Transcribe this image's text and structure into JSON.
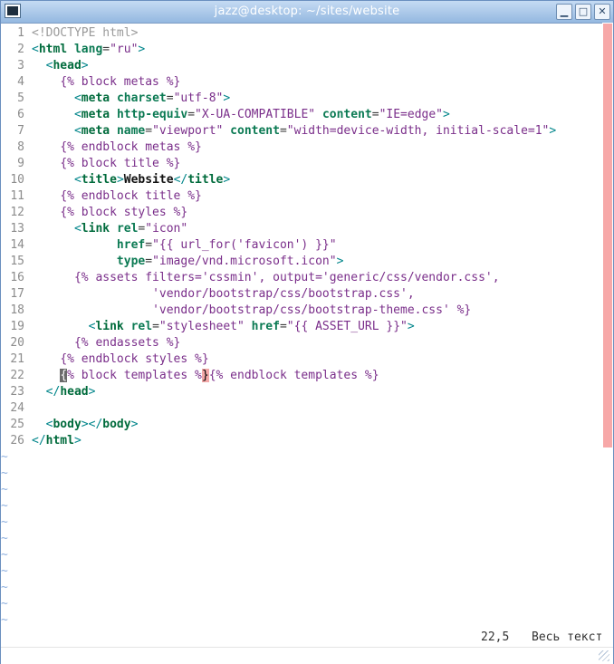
{
  "window": {
    "title": "jazz@desktop: ~/sites/website",
    "controls": {
      "minimize": "▁",
      "maximize": "□",
      "close": "✕"
    }
  },
  "editor": {
    "lines": [
      {
        "n": "1",
        "parts": [
          [
            "doctype",
            "<!DOCTYPE html>"
          ]
        ]
      },
      {
        "n": "2",
        "parts": [
          [
            "tag",
            "<"
          ],
          [
            "tagname",
            "html "
          ],
          [
            "attr",
            "lang"
          ],
          [
            "txt",
            "="
          ],
          [
            "str",
            "\"ru\""
          ],
          [
            "tag",
            ">"
          ]
        ]
      },
      {
        "n": "3",
        "parts": [
          [
            "txt",
            "  "
          ],
          [
            "tag",
            "<"
          ],
          [
            "tagname",
            "head"
          ],
          [
            "tag",
            ">"
          ]
        ]
      },
      {
        "n": "4",
        "parts": [
          [
            "txt",
            "    "
          ],
          [
            "tmpl",
            "{% block metas %}"
          ]
        ]
      },
      {
        "n": "5",
        "parts": [
          [
            "txt",
            "      "
          ],
          [
            "tag",
            "<"
          ],
          [
            "tagname",
            "meta "
          ],
          [
            "attr",
            "charset"
          ],
          [
            "txt",
            "="
          ],
          [
            "str",
            "\"utf-8\""
          ],
          [
            "tag",
            ">"
          ]
        ]
      },
      {
        "n": "6",
        "parts": [
          [
            "txt",
            "      "
          ],
          [
            "tag",
            "<"
          ],
          [
            "tagname",
            "meta "
          ],
          [
            "attr",
            "http-equiv"
          ],
          [
            "txt",
            "="
          ],
          [
            "str",
            "\"X-UA-COMPATIBLE\" "
          ],
          [
            "attr",
            "content"
          ],
          [
            "txt",
            "="
          ],
          [
            "str",
            "\"IE=edge\""
          ],
          [
            "tag",
            ">"
          ]
        ]
      },
      {
        "n": "7",
        "parts": [
          [
            "txt",
            "      "
          ],
          [
            "tag",
            "<"
          ],
          [
            "tagname",
            "meta "
          ],
          [
            "attr",
            "name"
          ],
          [
            "txt",
            "="
          ],
          [
            "str",
            "\"viewport\" "
          ],
          [
            "attr",
            "content"
          ],
          [
            "txt",
            "="
          ],
          [
            "str",
            "\"width=device-width, initial-scale=1\""
          ],
          [
            "tag",
            ">"
          ]
        ]
      },
      {
        "n": "8",
        "parts": [
          [
            "txt",
            "    "
          ],
          [
            "tmpl",
            "{% endblock metas %}"
          ]
        ]
      },
      {
        "n": "9",
        "parts": [
          [
            "txt",
            "    "
          ],
          [
            "tmpl",
            "{% block title %}"
          ]
        ]
      },
      {
        "n": "10",
        "parts": [
          [
            "txt",
            "      "
          ],
          [
            "tag",
            "<"
          ],
          [
            "tagname",
            "title"
          ],
          [
            "tag",
            ">"
          ],
          [
            "bold",
            "Website"
          ],
          [
            "tag",
            "</"
          ],
          [
            "tagname",
            "title"
          ],
          [
            "tag",
            ">"
          ]
        ]
      },
      {
        "n": "11",
        "parts": [
          [
            "txt",
            "    "
          ],
          [
            "tmpl",
            "{% endblock title %}"
          ]
        ]
      },
      {
        "n": "12",
        "parts": [
          [
            "txt",
            "    "
          ],
          [
            "tmpl",
            "{% block styles %}"
          ]
        ]
      },
      {
        "n": "13",
        "parts": [
          [
            "txt",
            "      "
          ],
          [
            "tag",
            "<"
          ],
          [
            "tagname",
            "link "
          ],
          [
            "attr",
            "rel"
          ],
          [
            "txt",
            "="
          ],
          [
            "str",
            "\"icon\""
          ]
        ]
      },
      {
        "n": "14",
        "parts": [
          [
            "txt",
            "            "
          ],
          [
            "attr",
            "href"
          ],
          [
            "txt",
            "="
          ],
          [
            "str",
            "\"{{ url_for('favicon') }}\""
          ]
        ]
      },
      {
        "n": "15",
        "parts": [
          [
            "txt",
            "            "
          ],
          [
            "attr",
            "type"
          ],
          [
            "txt",
            "="
          ],
          [
            "str",
            "\"image/vnd.microsoft.icon\""
          ],
          [
            "tag",
            ">"
          ]
        ]
      },
      {
        "n": "16",
        "parts": [
          [
            "txt",
            "      "
          ],
          [
            "tmpl",
            "{% assets filters='cssmin', output='generic/css/vendor.css',"
          ]
        ]
      },
      {
        "n": "17",
        "parts": [
          [
            "txt",
            "                 "
          ],
          [
            "tmpl",
            "'vendor/bootstrap/css/bootstrap.css',"
          ]
        ]
      },
      {
        "n": "18",
        "parts": [
          [
            "txt",
            "                 "
          ],
          [
            "tmpl",
            "'vendor/bootstrap/css/bootstrap-theme.css' %}"
          ]
        ]
      },
      {
        "n": "19",
        "parts": [
          [
            "txt",
            "        "
          ],
          [
            "tag",
            "<"
          ],
          [
            "tagname",
            "link "
          ],
          [
            "attr",
            "rel"
          ],
          [
            "txt",
            "="
          ],
          [
            "str",
            "\"stylesheet\" "
          ],
          [
            "attr",
            "href"
          ],
          [
            "txt",
            "="
          ],
          [
            "str",
            "\"{{ ASSET_URL }}\""
          ],
          [
            "tag",
            ">"
          ]
        ]
      },
      {
        "n": "20",
        "parts": [
          [
            "txt",
            "      "
          ],
          [
            "tmpl",
            "{% endassets %}"
          ]
        ]
      },
      {
        "n": "21",
        "parts": [
          [
            "txt",
            "    "
          ],
          [
            "tmpl",
            "{% endblock styles %}"
          ]
        ]
      },
      {
        "n": "22",
        "parts": [
          [
            "txt",
            "    "
          ],
          [
            "cursor",
            "{"
          ],
          [
            "tmpl",
            "% block templates %"
          ],
          [
            "match",
            "}"
          ],
          [
            "tmpl",
            "{% endblock templates %}"
          ]
        ]
      },
      {
        "n": "23",
        "parts": [
          [
            "txt",
            "  "
          ],
          [
            "tag",
            "</"
          ],
          [
            "tagname",
            "head"
          ],
          [
            "tag",
            ">"
          ]
        ]
      },
      {
        "n": "24",
        "parts": []
      },
      {
        "n": "25",
        "parts": [
          [
            "txt",
            "  "
          ],
          [
            "tag",
            "<"
          ],
          [
            "tagname",
            "body"
          ],
          [
            "tag",
            "></"
          ],
          [
            "tagname",
            "body"
          ],
          [
            "tag",
            ">"
          ]
        ]
      },
      {
        "n": "26",
        "parts": [
          [
            "tag",
            "</"
          ],
          [
            "tagname",
            "html"
          ],
          [
            "tag",
            ">"
          ]
        ]
      }
    ],
    "tildes": [
      "~",
      "~",
      "~",
      "~",
      "~",
      "~",
      "~",
      "~",
      "~",
      "~",
      "~"
    ]
  },
  "status": {
    "position": "22,5",
    "scroll": "Весь текст"
  },
  "colors": {
    "titlebar": "#a9c8ea",
    "scroll_thumb": "#f7a8a8",
    "cursor": "#6a6a6a",
    "bracket_match": "#f3a8a8"
  }
}
